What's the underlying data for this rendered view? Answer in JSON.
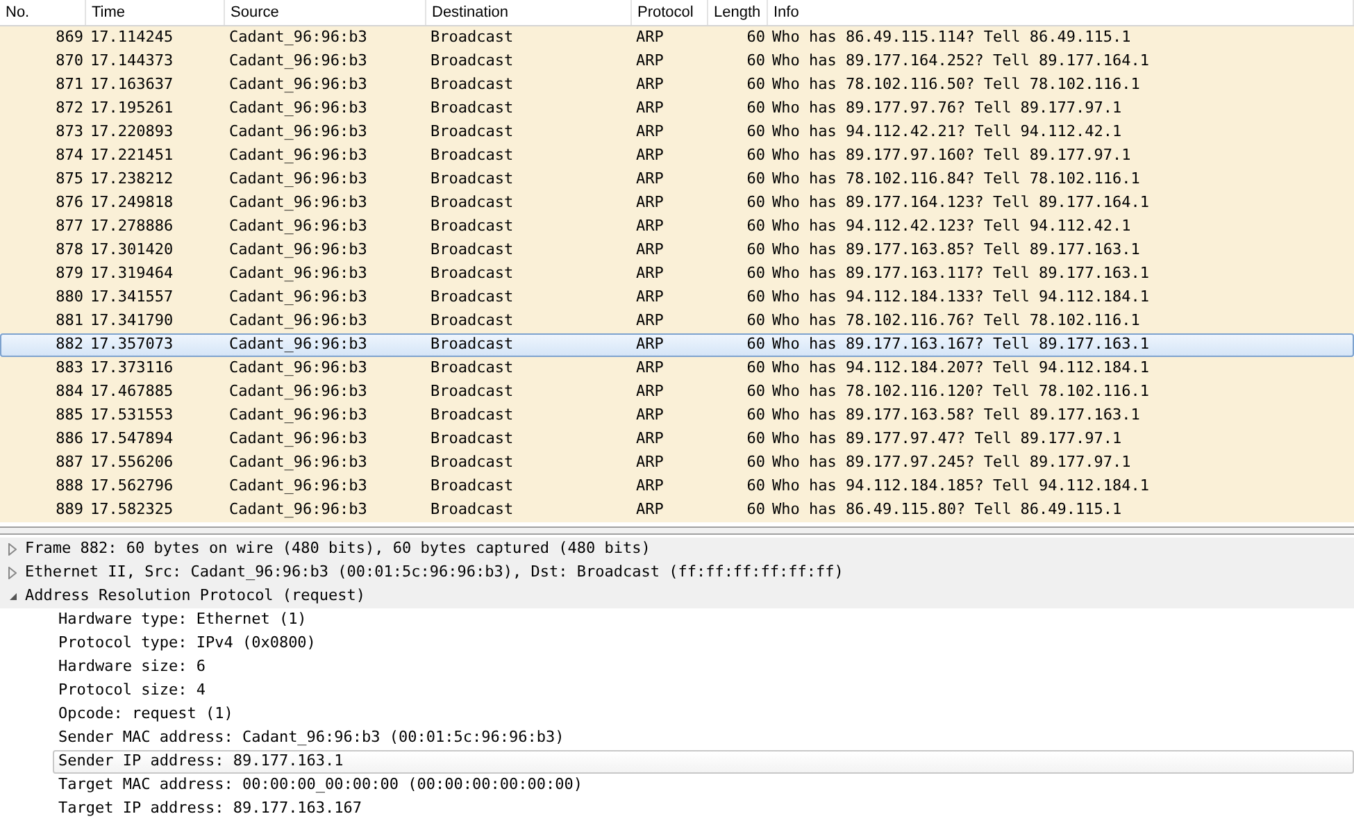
{
  "packet_list": {
    "columns": [
      "No.",
      "Time",
      "Source",
      "Destination",
      "Protocol",
      "Length",
      "Info"
    ],
    "rows": [
      {
        "no": "869",
        "time": "17.114245",
        "source": "Cadant_96:96:b3",
        "destination": "Broadcast",
        "protocol": "ARP",
        "length": "60",
        "info": "Who has 86.49.115.114? Tell 86.49.115.1",
        "selected": false
      },
      {
        "no": "870",
        "time": "17.144373",
        "source": "Cadant_96:96:b3",
        "destination": "Broadcast",
        "protocol": "ARP",
        "length": "60",
        "info": "Who has 89.177.164.252? Tell 89.177.164.1",
        "selected": false
      },
      {
        "no": "871",
        "time": "17.163637",
        "source": "Cadant_96:96:b3",
        "destination": "Broadcast",
        "protocol": "ARP",
        "length": "60",
        "info": "Who has 78.102.116.50? Tell 78.102.116.1",
        "selected": false
      },
      {
        "no": "872",
        "time": "17.195261",
        "source": "Cadant_96:96:b3",
        "destination": "Broadcast",
        "protocol": "ARP",
        "length": "60",
        "info": "Who has 89.177.97.76? Tell 89.177.97.1",
        "selected": false
      },
      {
        "no": "873",
        "time": "17.220893",
        "source": "Cadant_96:96:b3",
        "destination": "Broadcast",
        "protocol": "ARP",
        "length": "60",
        "info": "Who has 94.112.42.21? Tell 94.112.42.1",
        "selected": false
      },
      {
        "no": "874",
        "time": "17.221451",
        "source": "Cadant_96:96:b3",
        "destination": "Broadcast",
        "protocol": "ARP",
        "length": "60",
        "info": "Who has 89.177.97.160? Tell 89.177.97.1",
        "selected": false
      },
      {
        "no": "875",
        "time": "17.238212",
        "source": "Cadant_96:96:b3",
        "destination": "Broadcast",
        "protocol": "ARP",
        "length": "60",
        "info": "Who has 78.102.116.84? Tell 78.102.116.1",
        "selected": false
      },
      {
        "no": "876",
        "time": "17.249818",
        "source": "Cadant_96:96:b3",
        "destination": "Broadcast",
        "protocol": "ARP",
        "length": "60",
        "info": "Who has 89.177.164.123? Tell 89.177.164.1",
        "selected": false
      },
      {
        "no": "877",
        "time": "17.278886",
        "source": "Cadant_96:96:b3",
        "destination": "Broadcast",
        "protocol": "ARP",
        "length": "60",
        "info": "Who has 94.112.42.123? Tell 94.112.42.1",
        "selected": false
      },
      {
        "no": "878",
        "time": "17.301420",
        "source": "Cadant_96:96:b3",
        "destination": "Broadcast",
        "protocol": "ARP",
        "length": "60",
        "info": "Who has 89.177.163.85? Tell 89.177.163.1",
        "selected": false
      },
      {
        "no": "879",
        "time": "17.319464",
        "source": "Cadant_96:96:b3",
        "destination": "Broadcast",
        "protocol": "ARP",
        "length": "60",
        "info": "Who has 89.177.163.117? Tell 89.177.163.1",
        "selected": false
      },
      {
        "no": "880",
        "time": "17.341557",
        "source": "Cadant_96:96:b3",
        "destination": "Broadcast",
        "protocol": "ARP",
        "length": "60",
        "info": "Who has 94.112.184.133? Tell 94.112.184.1",
        "selected": false
      },
      {
        "no": "881",
        "time": "17.341790",
        "source": "Cadant_96:96:b3",
        "destination": "Broadcast",
        "protocol": "ARP",
        "length": "60",
        "info": "Who has 78.102.116.76? Tell 78.102.116.1",
        "selected": false
      },
      {
        "no": "882",
        "time": "17.357073",
        "source": "Cadant_96:96:b3",
        "destination": "Broadcast",
        "protocol": "ARP",
        "length": "60",
        "info": "Who has 89.177.163.167? Tell 89.177.163.1",
        "selected": true
      },
      {
        "no": "883",
        "time": "17.373116",
        "source": "Cadant_96:96:b3",
        "destination": "Broadcast",
        "protocol": "ARP",
        "length": "60",
        "info": "Who has 94.112.184.207? Tell 94.112.184.1",
        "selected": false
      },
      {
        "no": "884",
        "time": "17.467885",
        "source": "Cadant_96:96:b3",
        "destination": "Broadcast",
        "protocol": "ARP",
        "length": "60",
        "info": "Who has 78.102.116.120? Tell 78.102.116.1",
        "selected": false
      },
      {
        "no": "885",
        "time": "17.531553",
        "source": "Cadant_96:96:b3",
        "destination": "Broadcast",
        "protocol": "ARP",
        "length": "60",
        "info": "Who has 89.177.163.58? Tell 89.177.163.1",
        "selected": false
      },
      {
        "no": "886",
        "time": "17.547894",
        "source": "Cadant_96:96:b3",
        "destination": "Broadcast",
        "protocol": "ARP",
        "length": "60",
        "info": "Who has 89.177.97.47? Tell 89.177.97.1",
        "selected": false
      },
      {
        "no": "887",
        "time": "17.556206",
        "source": "Cadant_96:96:b3",
        "destination": "Broadcast",
        "protocol": "ARP",
        "length": "60",
        "info": "Who has 89.177.97.245? Tell 89.177.97.1",
        "selected": false
      },
      {
        "no": "888",
        "time": "17.562796",
        "source": "Cadant_96:96:b3",
        "destination": "Broadcast",
        "protocol": "ARP",
        "length": "60",
        "info": "Who has 94.112.184.185? Tell 94.112.184.1",
        "selected": false
      },
      {
        "no": "889",
        "time": "17.582325",
        "source": "Cadant_96:96:b3",
        "destination": "Broadcast",
        "protocol": "ARP",
        "length": "60",
        "info": "Who has 86.49.115.80? Tell 86.49.115.1",
        "selected": false
      }
    ]
  },
  "packet_details": [
    {
      "label": "Frame 882: 60 bytes on wire (480 bits), 60 bytes captured (480 bits)",
      "expanded": false
    },
    {
      "label": "Ethernet II, Src: Cadant_96:96:b3 (00:01:5c:96:96:b3), Dst: Broadcast (ff:ff:ff:ff:ff:ff)",
      "expanded": false
    },
    {
      "label": "Address Resolution Protocol (request)",
      "expanded": true,
      "children": [
        {
          "label": "Hardware type: Ethernet (1)",
          "selected": false
        },
        {
          "label": "Protocol type: IPv4 (0x0800)",
          "selected": false
        },
        {
          "label": "Hardware size: 6",
          "selected": false
        },
        {
          "label": "Protocol size: 4",
          "selected": false
        },
        {
          "label": "Opcode: request (1)",
          "selected": false
        },
        {
          "label": "Sender MAC address: Cadant_96:96:b3 (00:01:5c:96:96:b3)",
          "selected": false
        },
        {
          "label": "Sender IP address: 89.177.163.1",
          "selected": true
        },
        {
          "label": "Target MAC address: 00:00:00_00:00:00 (00:00:00:00:00:00)",
          "selected": false
        },
        {
          "label": "Target IP address: 89.177.163.167",
          "selected": false
        }
      ]
    }
  ]
}
